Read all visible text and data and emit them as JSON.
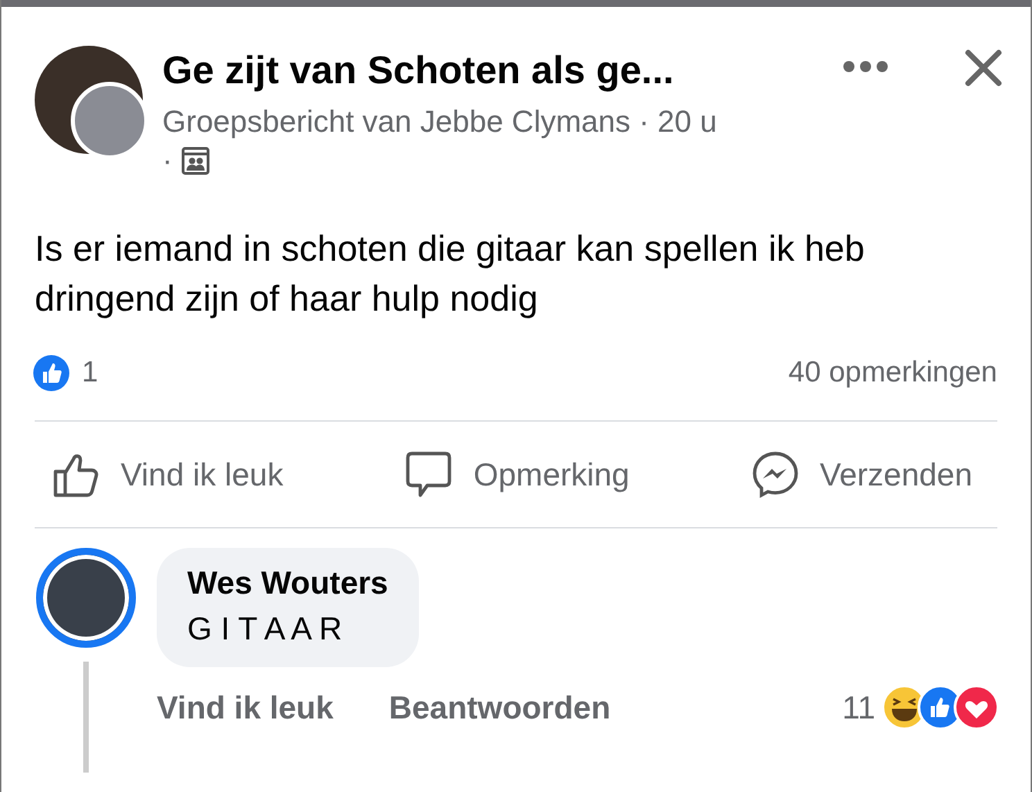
{
  "post": {
    "group_title": "Ge zijt van Schoten als ge...",
    "byline": "Groepsbericht van Jebbe Clymans · 20 u",
    "byline_dot": "·",
    "text": "Is er iemand in schoten die gitaar kan spellen ik heb dringend zijn of haar hulp nodig",
    "like_count": "1",
    "comment_count": "40 opmerkingen"
  },
  "actions": [
    {
      "kind": "like",
      "label": "Vind ik leuk"
    },
    {
      "kind": "comment",
      "label": "Opmerking"
    },
    {
      "kind": "send",
      "label": "Verzenden"
    }
  ],
  "comment": {
    "author": "Wes Wouters",
    "text": "G I T A A R",
    "actions": [
      "Vind ik leuk",
      "Beantwoorden"
    ],
    "reaction_count": "11"
  }
}
